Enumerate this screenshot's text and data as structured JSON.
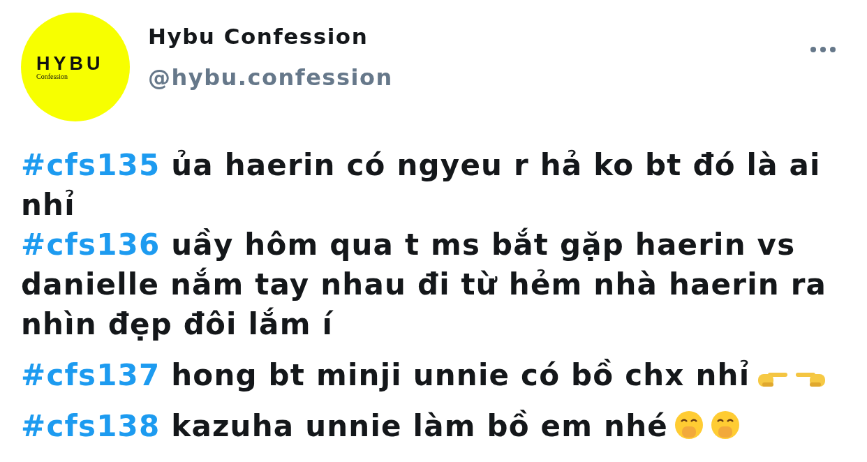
{
  "author": {
    "avatar": {
      "logo": "HYBU",
      "sub": "Confession"
    },
    "name": "Hybu Confession",
    "handle": "@hybu.confession"
  },
  "paragraphs": [
    {
      "lines": [
        {
          "tag": "#cfs135",
          "text": "ủa haerin có ngyeu r hả ko bt đó là ai nhỉ"
        },
        {
          "tag": "#cfs136",
          "text": "uầy hôm qua t ms bắt gặp haerin vs danielle nắm tay nhau đi từ hẻm nhà haerin ra nhìn đẹp đôi lắm í"
        }
      ]
    },
    {
      "lines": [
        {
          "tag": "#cfs137",
          "text": "hong bt minji unnie có bồ chx nhỉ",
          "icons": [
            {
              "kind": "point-right"
            },
            {
              "kind": "point-left"
            }
          ]
        }
      ]
    },
    {
      "lines": [
        {
          "tag": "#cfs138",
          "text": "kazuha unnie làm bồ em nhé",
          "icons": [
            {
              "kind": "hand-over-mouth"
            },
            {
              "kind": "hand-over-mouth"
            }
          ]
        }
      ]
    }
  ]
}
